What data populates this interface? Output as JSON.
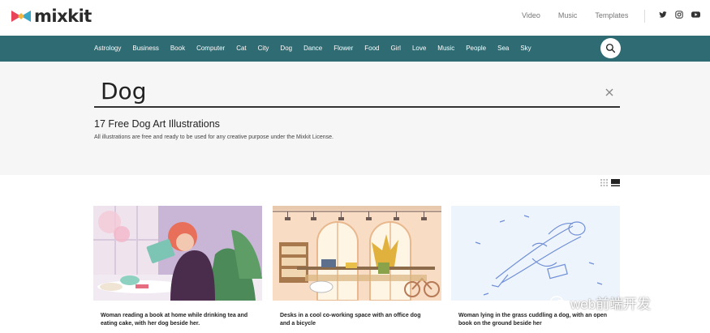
{
  "brand": {
    "name": "mixkit"
  },
  "top_nav": {
    "links": [
      "Video",
      "Music",
      "Templates"
    ]
  },
  "social": [
    "twitter-icon",
    "instagram-icon",
    "youtube-icon"
  ],
  "categories": [
    "Astrology",
    "Business",
    "Book",
    "Computer",
    "Cat",
    "City",
    "Dog",
    "Dance",
    "Flower",
    "Food",
    "Girl",
    "Love",
    "Music",
    "People",
    "Sea",
    "Sky"
  ],
  "search": {
    "term": "Dog"
  },
  "results": {
    "title": "17 Free Dog Art Illustrations",
    "subtitle": "All illustrations are free and ready to be used for any creative purpose under the Mixkit License."
  },
  "cards": [
    {
      "caption": "Woman reading a book at home while drinking tea and eating cake, with her dog beside her."
    },
    {
      "caption": "Desks in a cool co-working space with an office dog and a bicycle"
    },
    {
      "caption": "Woman lying in the grass cuddling a dog, with an open book on the ground beside her"
    }
  ],
  "watermark": {
    "text": "web前端开发"
  },
  "colors": {
    "accent": "#2f6b73",
    "hero_bg": "#f6f6f6"
  }
}
